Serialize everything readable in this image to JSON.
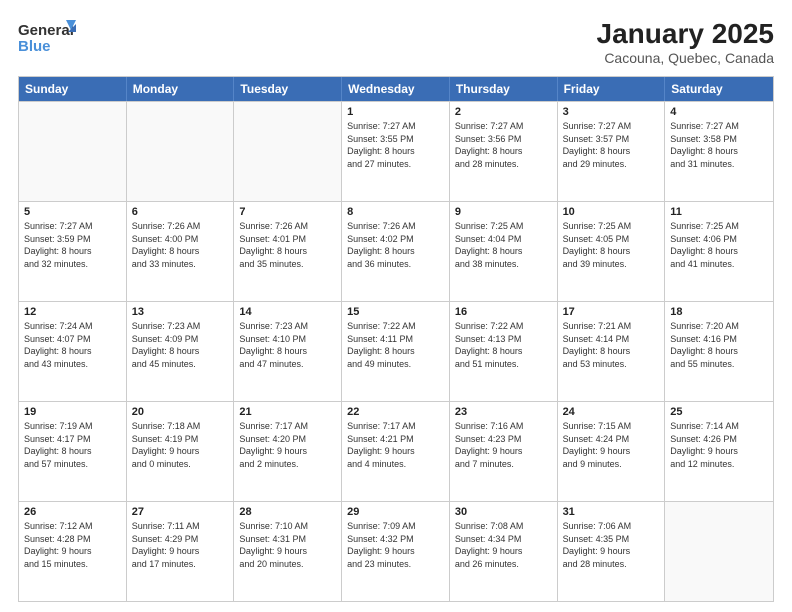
{
  "logo": {
    "general": "General",
    "blue": "Blue"
  },
  "title": "January 2025",
  "subtitle": "Cacouna, Quebec, Canada",
  "days": [
    "Sunday",
    "Monday",
    "Tuesday",
    "Wednesday",
    "Thursday",
    "Friday",
    "Saturday"
  ],
  "weeks": [
    [
      {
        "day": "",
        "text": "",
        "empty": true
      },
      {
        "day": "",
        "text": "",
        "empty": true
      },
      {
        "day": "",
        "text": "",
        "empty": true
      },
      {
        "day": "1",
        "text": "Sunrise: 7:27 AM\nSunset: 3:55 PM\nDaylight: 8 hours\nand 27 minutes."
      },
      {
        "day": "2",
        "text": "Sunrise: 7:27 AM\nSunset: 3:56 PM\nDaylight: 8 hours\nand 28 minutes."
      },
      {
        "day": "3",
        "text": "Sunrise: 7:27 AM\nSunset: 3:57 PM\nDaylight: 8 hours\nand 29 minutes."
      },
      {
        "day": "4",
        "text": "Sunrise: 7:27 AM\nSunset: 3:58 PM\nDaylight: 8 hours\nand 31 minutes."
      }
    ],
    [
      {
        "day": "5",
        "text": "Sunrise: 7:27 AM\nSunset: 3:59 PM\nDaylight: 8 hours\nand 32 minutes."
      },
      {
        "day": "6",
        "text": "Sunrise: 7:26 AM\nSunset: 4:00 PM\nDaylight: 8 hours\nand 33 minutes."
      },
      {
        "day": "7",
        "text": "Sunrise: 7:26 AM\nSunset: 4:01 PM\nDaylight: 8 hours\nand 35 minutes."
      },
      {
        "day": "8",
        "text": "Sunrise: 7:26 AM\nSunset: 4:02 PM\nDaylight: 8 hours\nand 36 minutes."
      },
      {
        "day": "9",
        "text": "Sunrise: 7:25 AM\nSunset: 4:04 PM\nDaylight: 8 hours\nand 38 minutes."
      },
      {
        "day": "10",
        "text": "Sunrise: 7:25 AM\nSunset: 4:05 PM\nDaylight: 8 hours\nand 39 minutes."
      },
      {
        "day": "11",
        "text": "Sunrise: 7:25 AM\nSunset: 4:06 PM\nDaylight: 8 hours\nand 41 minutes."
      }
    ],
    [
      {
        "day": "12",
        "text": "Sunrise: 7:24 AM\nSunset: 4:07 PM\nDaylight: 8 hours\nand 43 minutes."
      },
      {
        "day": "13",
        "text": "Sunrise: 7:23 AM\nSunset: 4:09 PM\nDaylight: 8 hours\nand 45 minutes."
      },
      {
        "day": "14",
        "text": "Sunrise: 7:23 AM\nSunset: 4:10 PM\nDaylight: 8 hours\nand 47 minutes."
      },
      {
        "day": "15",
        "text": "Sunrise: 7:22 AM\nSunset: 4:11 PM\nDaylight: 8 hours\nand 49 minutes."
      },
      {
        "day": "16",
        "text": "Sunrise: 7:22 AM\nSunset: 4:13 PM\nDaylight: 8 hours\nand 51 minutes."
      },
      {
        "day": "17",
        "text": "Sunrise: 7:21 AM\nSunset: 4:14 PM\nDaylight: 8 hours\nand 53 minutes."
      },
      {
        "day": "18",
        "text": "Sunrise: 7:20 AM\nSunset: 4:16 PM\nDaylight: 8 hours\nand 55 minutes."
      }
    ],
    [
      {
        "day": "19",
        "text": "Sunrise: 7:19 AM\nSunset: 4:17 PM\nDaylight: 8 hours\nand 57 minutes."
      },
      {
        "day": "20",
        "text": "Sunrise: 7:18 AM\nSunset: 4:19 PM\nDaylight: 9 hours\nand 0 minutes."
      },
      {
        "day": "21",
        "text": "Sunrise: 7:17 AM\nSunset: 4:20 PM\nDaylight: 9 hours\nand 2 minutes."
      },
      {
        "day": "22",
        "text": "Sunrise: 7:17 AM\nSunset: 4:21 PM\nDaylight: 9 hours\nand 4 minutes."
      },
      {
        "day": "23",
        "text": "Sunrise: 7:16 AM\nSunset: 4:23 PM\nDaylight: 9 hours\nand 7 minutes."
      },
      {
        "day": "24",
        "text": "Sunrise: 7:15 AM\nSunset: 4:24 PM\nDaylight: 9 hours\nand 9 minutes."
      },
      {
        "day": "25",
        "text": "Sunrise: 7:14 AM\nSunset: 4:26 PM\nDaylight: 9 hours\nand 12 minutes."
      }
    ],
    [
      {
        "day": "26",
        "text": "Sunrise: 7:12 AM\nSunset: 4:28 PM\nDaylight: 9 hours\nand 15 minutes."
      },
      {
        "day": "27",
        "text": "Sunrise: 7:11 AM\nSunset: 4:29 PM\nDaylight: 9 hours\nand 17 minutes."
      },
      {
        "day": "28",
        "text": "Sunrise: 7:10 AM\nSunset: 4:31 PM\nDaylight: 9 hours\nand 20 minutes."
      },
      {
        "day": "29",
        "text": "Sunrise: 7:09 AM\nSunset: 4:32 PM\nDaylight: 9 hours\nand 23 minutes."
      },
      {
        "day": "30",
        "text": "Sunrise: 7:08 AM\nSunset: 4:34 PM\nDaylight: 9 hours\nand 26 minutes."
      },
      {
        "day": "31",
        "text": "Sunrise: 7:06 AM\nSunset: 4:35 PM\nDaylight: 9 hours\nand 28 minutes."
      },
      {
        "day": "",
        "text": "",
        "empty": true
      }
    ]
  ]
}
